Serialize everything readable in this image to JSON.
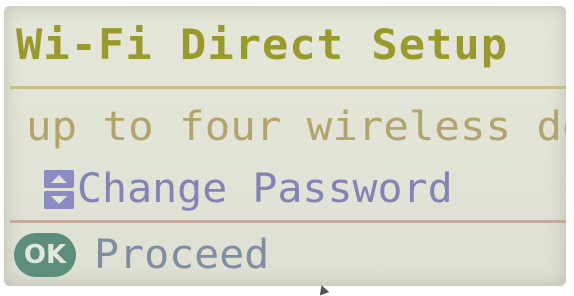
{
  "screen": {
    "title": "Wi-Fi Direct Setup",
    "scroll_text": "up to four wireless de",
    "option_label": "Change Password",
    "option_icon": "up-down-arrows-icon",
    "ok_button_label": "OK",
    "proceed_label": "Proceed"
  },
  "colors": {
    "lcd_background": "#e2e4d7",
    "title": "#9a9a2c",
    "scroll_text": "#b3a36c",
    "option_text": "#8383b7",
    "ok_button": "#5d8e7b",
    "proceed_text": "#7f8ea0"
  }
}
